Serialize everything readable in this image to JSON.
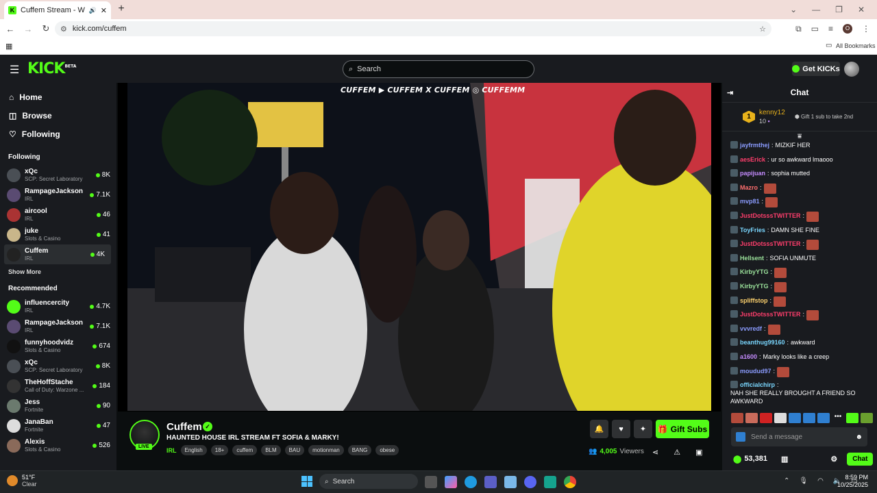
{
  "browser": {
    "tab_title": "Cuffem Stream - Watch Live",
    "url": "kick.com/cuffem",
    "all_bookmarks": "All Bookmarks",
    "profile_initial": "O"
  },
  "header": {
    "logo": "KICK",
    "logo_beta": "BETA",
    "search_placeholder": "Search",
    "get_kicks": "Get KICKs"
  },
  "sidebar": {
    "nav": [
      {
        "label": "Home"
      },
      {
        "label": "Browse"
      },
      {
        "label": "Following"
      }
    ],
    "following_title": "Following",
    "following": [
      {
        "name": "xQc",
        "category": "SCP: Secret Laboratory",
        "viewers": "8K",
        "color": "#4a4f55"
      },
      {
        "name": "RampageJackson",
        "category": "IRL",
        "viewers": "7.1K",
        "color": "#5a4b72"
      },
      {
        "name": "aircool",
        "category": "IRL",
        "viewers": "46",
        "color": "#a33"
      },
      {
        "name": "juke",
        "category": "Slots & Casino",
        "viewers": "41",
        "color": "#c9b68a"
      },
      {
        "name": "Cuffem",
        "category": "IRL",
        "viewers": "4K",
        "color": "#222"
      }
    ],
    "show_more": "Show More",
    "recommended_title": "Recommended",
    "recommended": [
      {
        "name": "influencercity",
        "category": "IRL",
        "viewers": "4.7K",
        "color": "#53fc18"
      },
      {
        "name": "RampageJackson",
        "category": "IRL",
        "viewers": "7.1K",
        "color": "#5a4b72"
      },
      {
        "name": "funnyhoodvidz",
        "category": "Slots & Casino",
        "viewers": "674",
        "color": "#111"
      },
      {
        "name": "xQc",
        "category": "SCP: Secret Laboratory",
        "viewers": "8K",
        "color": "#4a4f55"
      },
      {
        "name": "TheHoffStache",
        "category": "Call of Duty: Warzone ...",
        "viewers": "184",
        "color": "#333"
      },
      {
        "name": "Jess",
        "category": "Fortnite",
        "viewers": "90",
        "color": "#6b7a6e"
      },
      {
        "name": "JanaBan",
        "category": "Fortnite",
        "viewers": "47",
        "color": "#ddd"
      },
      {
        "name": "Alexis",
        "category": "Slots & Casino",
        "viewers": "526",
        "color": "#8a6a5a"
      }
    ]
  },
  "video": {
    "overlay_text": "CUFFEM ▶ CUFFEM X CUFFEM ◎ CUFFEMM"
  },
  "stream": {
    "streamer": "Cuffem",
    "live": "LIVE",
    "title": "HAUNTED HOUSE IRL STREAM FT SOFIA & MARKY!",
    "category": "IRL",
    "tags": [
      "English",
      "18+",
      "cuffem",
      "BLM",
      "BAU",
      "motionman",
      "BANG",
      "obese"
    ],
    "gift_subs": "Gift Subs",
    "viewers": "4,005",
    "viewers_label": "Viewers"
  },
  "chat": {
    "title": "Chat",
    "pinned_user": "kenny12",
    "pinned_count": "10",
    "pinned_rank": "1",
    "pinned_action": "Gift 1 sub to take 2nd",
    "messages": [
      {
        "user": "jayfrmthej",
        "color": "#8b9cff",
        "text": "MIZKIF HER",
        "emote": false
      },
      {
        "user": "aesErick",
        "color": "#ff3e6c",
        "text": "ur so awkward lmaooo",
        "emote": false
      },
      {
        "user": "papijuan",
        "color": "#c58cff",
        "text": "sophia mutted",
        "emote": false
      },
      {
        "user": "Mazro",
        "color": "#ff6e6e",
        "text": "",
        "emote": true
      },
      {
        "user": "mvp81",
        "color": "#8b9cff",
        "text": "",
        "emote": true
      },
      {
        "user": "JustDotsssTWITTER",
        "color": "#ff3e6c",
        "text": "",
        "emote": true
      },
      {
        "user": "ToyFries",
        "color": "#7ad7ff",
        "text": "DAMN SHE FINE",
        "emote": false
      },
      {
        "user": "JustDotsssTWITTER",
        "color": "#ff3e6c",
        "text": "",
        "emote": true
      },
      {
        "user": "Hellsent",
        "color": "#9be29b",
        "text": "SOFIA UNMUTE",
        "emote": false
      },
      {
        "user": "KirbyYTG",
        "color": "#9be29b",
        "text": "",
        "emote": true
      },
      {
        "user": "KirbyYTG",
        "color": "#9be29b",
        "text": "",
        "emote": true
      },
      {
        "user": "spliffstop",
        "color": "#ffd36e",
        "text": "",
        "emote": true
      },
      {
        "user": "JustDotsssTWITTER",
        "color": "#ff3e6c",
        "text": "",
        "emote": true
      },
      {
        "user": "vvvredf",
        "color": "#8b9cff",
        "text": "",
        "emote": true
      },
      {
        "user": "beanthug99160",
        "color": "#7ad7ff",
        "text": "awkward",
        "emote": false
      },
      {
        "user": "a1600",
        "color": "#c58cff",
        "text": "Marky looks like a creep",
        "emote": false
      },
      {
        "user": "moudud97",
        "color": "#8b9cff",
        "text": "",
        "emote": true
      },
      {
        "user": "officialchirp",
        "color": "#7ad7ff",
        "text": "NAH SHE REALLY BROUGHT A FRIEND SO AWKWARD",
        "emote": false
      }
    ],
    "input_placeholder": "Send a message",
    "points": "53,381",
    "chat_button": "Chat"
  },
  "taskbar": {
    "weather_temp": "51°F",
    "weather_desc": "Clear",
    "search": "Search",
    "time": "8:59 PM",
    "date": "10/25/2025"
  }
}
